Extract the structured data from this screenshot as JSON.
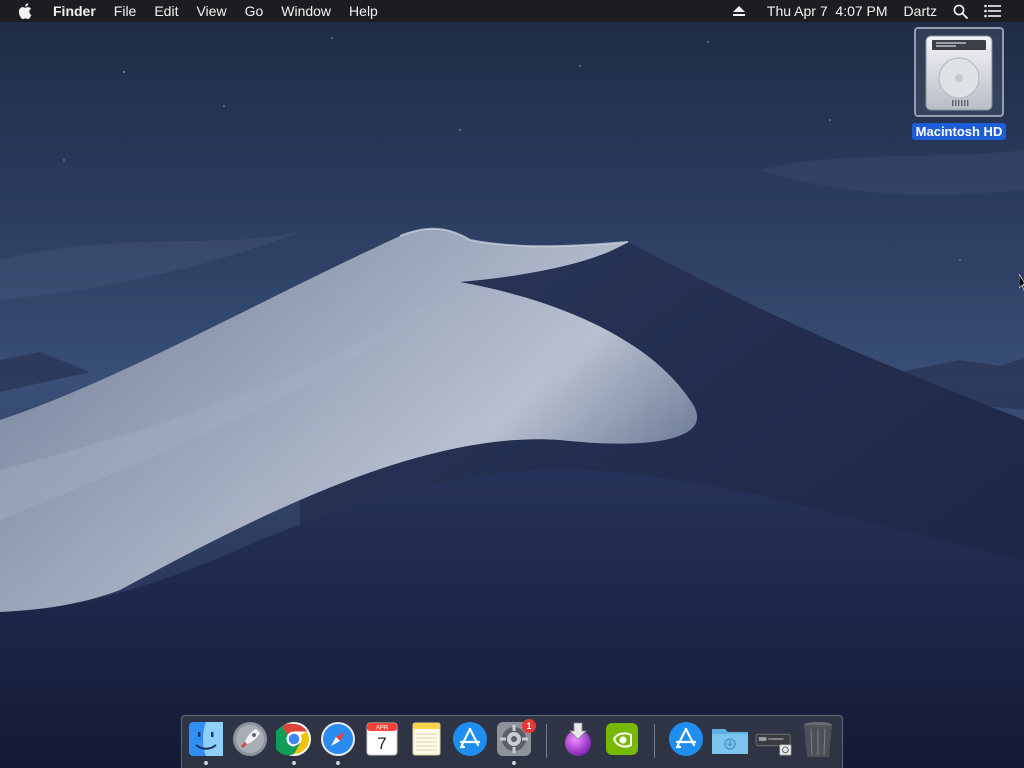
{
  "menubar": {
    "apple_icon": "apple-logo-icon",
    "app_name": "Finder",
    "menus": [
      "File",
      "Edit",
      "View",
      "Go",
      "Window",
      "Help"
    ],
    "status": {
      "eject_icon": "eject-icon",
      "datetime": "Thu Apr 7  4:07 PM",
      "user": "Dartz",
      "spotlight_icon": "search-icon",
      "notification_icon": "list-icon"
    }
  },
  "desktop": {
    "icons": [
      {
        "label": "Macintosh HD",
        "icon": "hard-drive-icon",
        "selected": true
      }
    ]
  },
  "dock": {
    "items": [
      {
        "name": "Finder",
        "icon": "finder-icon",
        "running": true
      },
      {
        "name": "Launchpad",
        "icon": "launchpad-icon",
        "running": false
      },
      {
        "name": "Google Chrome",
        "icon": "chrome-icon",
        "running": true
      },
      {
        "name": "Safari",
        "icon": "safari-icon",
        "running": true
      },
      {
        "name": "Calendar",
        "icon": "calendar-icon",
        "running": false,
        "month": "APR",
        "day": "7"
      },
      {
        "name": "Notes",
        "icon": "notes-icon",
        "running": false
      },
      {
        "name": "App Store",
        "icon": "app-store-icon",
        "running": false
      },
      {
        "name": "System Preferences",
        "icon": "gear-icon",
        "running": true,
        "badge": "1"
      },
      {
        "name": "Installer",
        "icon": "installer-icon",
        "running": false
      },
      {
        "name": "NVIDIA",
        "icon": "nvidia-icon",
        "running": false
      },
      {
        "name": "App Store",
        "icon": "app-store-icon",
        "running": false
      },
      {
        "name": "Folder",
        "icon": "folder-icon",
        "running": false
      },
      {
        "name": "Disk",
        "icon": "disk-icon",
        "running": false
      },
      {
        "name": "Trash",
        "icon": "trash-icon",
        "running": false
      }
    ]
  },
  "colors": {
    "menubar_bg": "#1c1c1e",
    "selection_blue": "#1d5dd8",
    "badge_red": "#e5392f"
  }
}
